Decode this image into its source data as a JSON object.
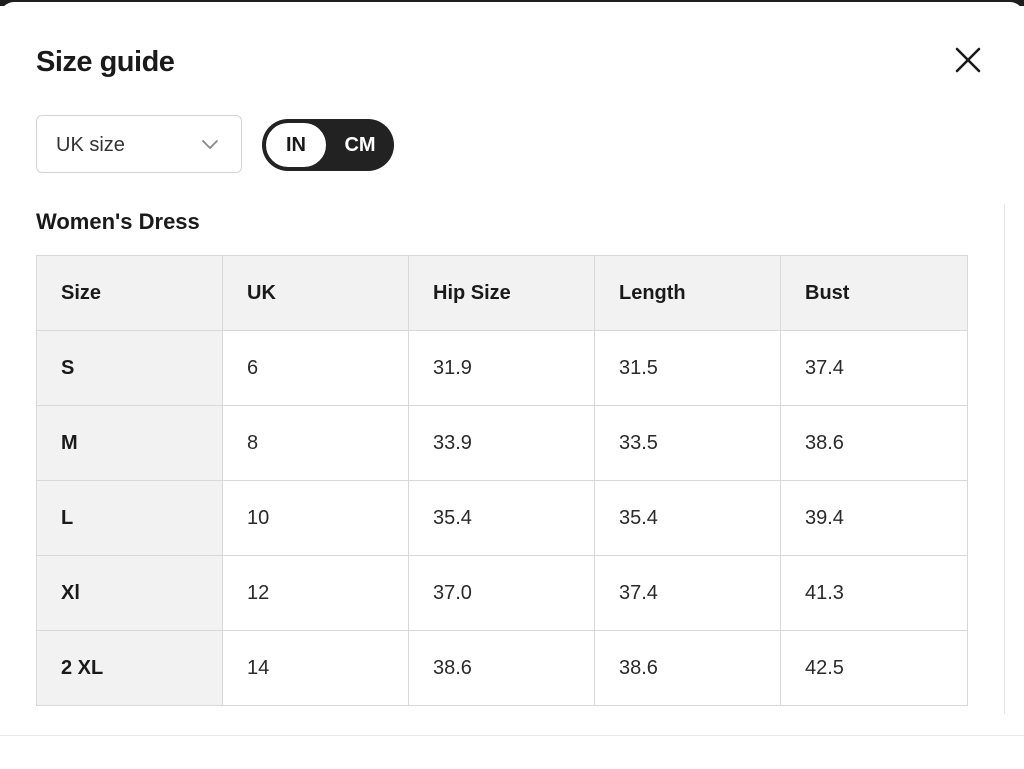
{
  "modal": {
    "title": "Size guide",
    "close_icon": "close-icon"
  },
  "controls": {
    "size_system_select": {
      "value": "UK size",
      "icon": "chevron-down-icon"
    },
    "unit_toggle": {
      "options": [
        "IN",
        "CM"
      ],
      "selected": "IN"
    }
  },
  "section": {
    "title": "Women's Dress"
  },
  "size_table": {
    "headers": [
      "Size",
      "UK",
      "Hip Size",
      "Length",
      "Bust"
    ],
    "rows": [
      [
        "S",
        "6",
        "31.9",
        "31.5",
        "37.4"
      ],
      [
        "M",
        "8",
        "33.9",
        "33.5",
        "38.6"
      ],
      [
        "L",
        "10",
        "35.4",
        "35.4",
        "39.4"
      ],
      [
        "Xl",
        "12",
        "37.0",
        "37.4",
        "41.3"
      ],
      [
        "2 XL",
        "14",
        "38.6",
        "38.6",
        "42.5"
      ]
    ]
  },
  "colors": {
    "toggle_dark": "#222222",
    "header_bg": "#f2f2f2",
    "border": "#d8d8d8"
  }
}
